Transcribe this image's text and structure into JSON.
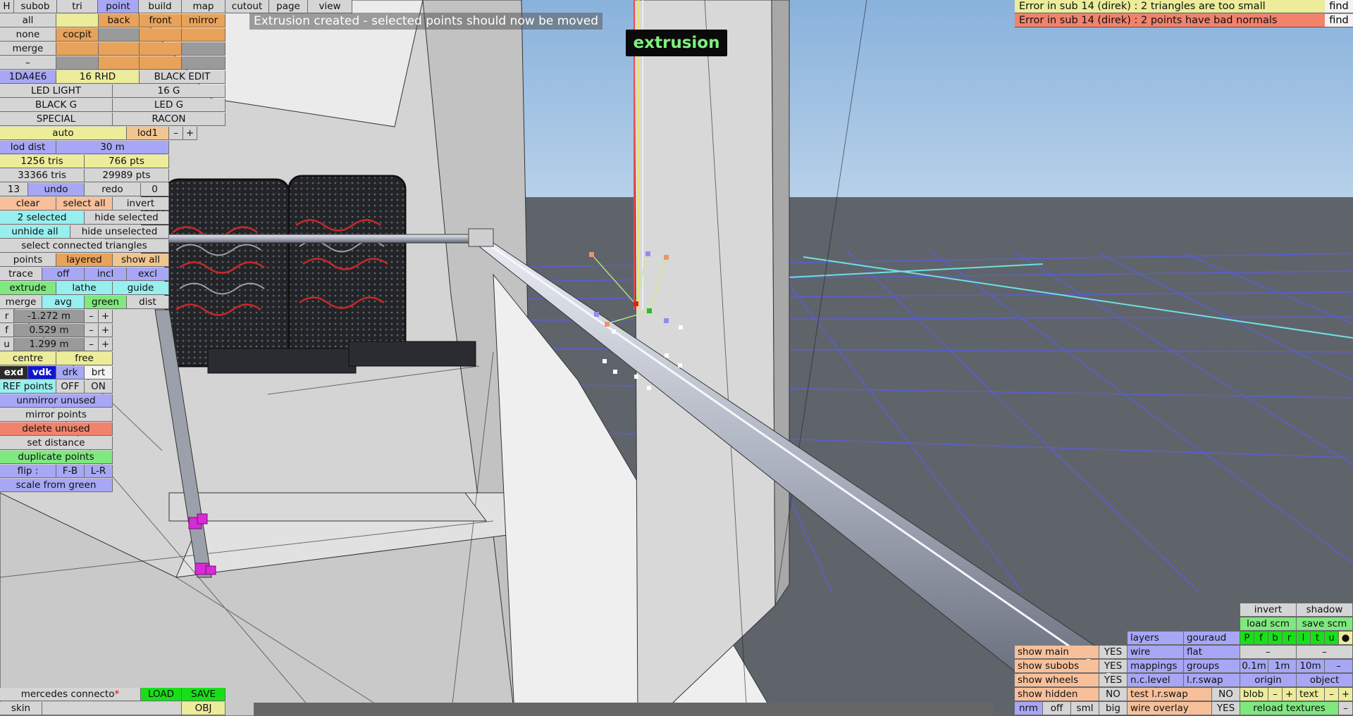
{
  "top_menu": [
    "H",
    "subob",
    "tri",
    "point",
    "build",
    "map",
    "cutout",
    "page",
    "view"
  ],
  "status_message": "Extrusion created - selected points should now be moved",
  "mode_badge": "extrusion",
  "errors": [
    {
      "text": "Error in sub 14 (direk) : 2 triangles are too small",
      "find": "find"
    },
    {
      "text": "Error in sub 14 (direk) : 2 points have bad normals",
      "find": "find"
    }
  ],
  "left": {
    "all": "all",
    "back": "back",
    "front": "front",
    "mirror": "mirror",
    "none": "none",
    "copypt": "cocpit",
    "merge": "merge",
    "dash": "–",
    "id": "1DA4E6",
    "rhd": "16 RHD",
    "black_edit": "BLACK EDIT",
    "led_light": "LED LIGHT",
    "g16": "16 G",
    "black_g": "BLACK G",
    "led_g": "LED G",
    "special": "SPECIAL",
    "racon": "RACON",
    "auto": "auto",
    "lod1": "lod1",
    "minus": "–",
    "plus": "+",
    "lod_dist": "lod dist",
    "lod_dist_val": "30 m",
    "tris": "1256 tris",
    "pts": "766 pts",
    "tris_total": "33366 tris",
    "pts_total": "29989 pts",
    "undo_count": "13",
    "undo": "undo",
    "redo": "redo",
    "redo_count": "0",
    "clear": "clear",
    "select_all": "select all",
    "invert": "invert",
    "selected": "2 selected",
    "hide_selected": "hide selected",
    "unhide_all": "unhide all",
    "hide_unselected": "hide unselected",
    "select_connected": "select connected triangles",
    "points": "points",
    "layered": "layered",
    "show_all": "show all",
    "trace": "trace",
    "off": "off",
    "incl": "incl",
    "excl": "excl",
    "extrude": "extrude",
    "lathe": "lathe",
    "guide": "guide",
    "merge2": "merge",
    "avg": "avg",
    "green": "green",
    "dist": "dist",
    "r": "r",
    "r_val": "-1.272 m",
    "f": "f",
    "f_val": "0.529 m",
    "u": "u",
    "u_val": "1.299 m",
    "centre": "centre",
    "free": "free",
    "exd": "exd",
    "vdk": "vdk",
    "drk": "drk",
    "brt": "brt",
    "ref_points": "REF points",
    "ref_off": "OFF",
    "ref_on": "ON",
    "unmirror": "unmirror unused",
    "mirror_points": "mirror points",
    "delete_unused": "delete unused",
    "set_distance": "set distance",
    "duplicate": "duplicate points",
    "flip": "flip :",
    "fb": "F-B",
    "lr": "L-R",
    "scale_green": "scale from green"
  },
  "bottom_left": {
    "file": "mercedes connecto",
    "load": "LOAD",
    "save": "SAVE",
    "skin": "skin",
    "obj": "OBJ"
  },
  "right": {
    "invert": "invert",
    "shadow": "shadow",
    "load_scm": "load scm",
    "save_scm": "save scm",
    "layers": "layers",
    "gouraud": "gouraud",
    "pflags": [
      "P",
      "f",
      "b",
      "r",
      "l",
      "t",
      "u"
    ],
    "dot": "●",
    "show_main": "show main",
    "yes": "YES",
    "no": "NO",
    "wire": "wire",
    "flat": "flat",
    "dash1": "–",
    "dash2": "–",
    "show_subobs": "show subobs",
    "mappings": "mappings",
    "groups": "groups",
    "s01": "0.1m",
    "s1": "1m",
    "s10": "10m",
    "show_wheels": "show wheels",
    "nclevel": "n.c.level",
    "lrswap": "l.r.swap",
    "origin": "origin",
    "object": "object",
    "show_hidden": "show hidden",
    "test_lr": "test l.r.swap",
    "blob": "blob",
    "text": "text",
    "nrm": "nrm",
    "off": "off",
    "sml": "sml",
    "big": "big",
    "wire_overlay": "wire overlay",
    "reload": "reload textures"
  }
}
